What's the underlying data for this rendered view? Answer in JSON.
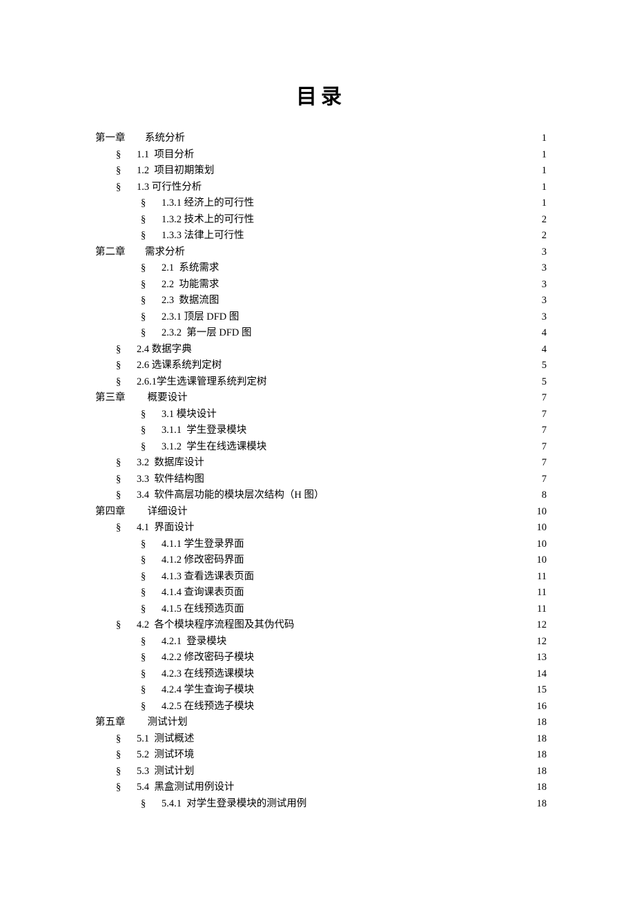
{
  "title": "目录",
  "bullet": "§",
  "entries": [
    {
      "indent": "indent-0",
      "type": "chapter",
      "label": "第一章",
      "text": "系统分析",
      "page": "1"
    },
    {
      "indent": "indent-1",
      "type": "bullet",
      "num": "1.1",
      "text": "项目分析",
      "page": "1"
    },
    {
      "indent": "indent-1",
      "type": "bullet",
      "num": "1.2",
      "text": "项目初期策划",
      "page": "1"
    },
    {
      "indent": "indent-1",
      "type": "bullet",
      "num": "1.3",
      "text": "可行性分析",
      "page": "1",
      "numtight": true
    },
    {
      "indent": "indent-2",
      "type": "bullet",
      "num": "1.3.1",
      "text": "经济上的可行性",
      "page": "1",
      "numtight": true
    },
    {
      "indent": "indent-2",
      "type": "bullet",
      "num": "1.3.2",
      "text": "技术上的可行性",
      "page": "2",
      "numtight": true
    },
    {
      "indent": "indent-2",
      "type": "bullet",
      "num": "1.3.3",
      "text": "法律上可行性",
      "page": "2",
      "numtight": true
    },
    {
      "indent": "indent-0",
      "type": "chapter",
      "label": "第二章",
      "text": "需求分析",
      "page": "3"
    },
    {
      "indent": "indent-2",
      "type": "bullet",
      "num": "2.1",
      "text": "系统需求",
      "page": "3"
    },
    {
      "indent": "indent-2",
      "type": "bullet",
      "num": "2.2",
      "text": "功能需求",
      "page": "3"
    },
    {
      "indent": "indent-2",
      "type": "bullet",
      "num": "2.3",
      "text": "数据流图",
      "page": "3"
    },
    {
      "indent": "indent-2",
      "type": "bullet",
      "num": "2.3.1",
      "text": "顶层 DFD 图",
      "page": "3",
      "numtight": true
    },
    {
      "indent": "indent-2",
      "type": "bullet",
      "num": "2.3.2",
      "text": " 第一层 DFD 图",
      "page": "4",
      "numtight": true
    },
    {
      "indent": "indent-1",
      "type": "bullet",
      "num": "2.4",
      "text": "数据字典",
      "page": "4",
      "numtight": true
    },
    {
      "indent": "indent-1",
      "type": "bullet",
      "num": "2.6",
      "text": "选课系统判定树",
      "page": "5",
      "numtight": true
    },
    {
      "indent": "indent-1",
      "type": "bullet",
      "num": "2.6.1",
      "text": "学生选课管理系统判定树",
      "page": "5",
      "numtight": true,
      "nogap": true
    },
    {
      "indent": "indent-0",
      "type": "chapter",
      "label": "第三章",
      "text": " 概要设计",
      "page": "7"
    },
    {
      "indent": "indent-2",
      "type": "bullet",
      "num": "3.1",
      "text": "模块设计",
      "page": "7",
      "numtight": true
    },
    {
      "indent": "indent-2",
      "type": "bullet",
      "num": "3.1.1",
      "text": " 学生登录模块",
      "page": "7",
      "numtight": true
    },
    {
      "indent": "indent-2",
      "type": "bullet",
      "num": "3.1.2",
      "text": " 学生在线选课模块",
      "page": "7",
      "numtight": true
    },
    {
      "indent": "indent-1",
      "type": "bullet",
      "num": "3.2",
      "text": " 数据库设计",
      "page": "7",
      "numtight": true
    },
    {
      "indent": "indent-1",
      "type": "bullet",
      "num": "3.3",
      "text": " 软件结构图",
      "page": "7",
      "numtight": true
    },
    {
      "indent": "indent-1",
      "type": "bullet",
      "num": "3.4",
      "text": " 软件高层功能的模块层次结构（H 图）",
      "page": "8",
      "numtight": true
    },
    {
      "indent": "indent-0",
      "type": "chapter",
      "label": "第四章",
      "text": " 详细设计",
      "page": "10"
    },
    {
      "indent": "indent-1",
      "type": "bullet",
      "num": "4.1",
      "text": " 界面设计",
      "page": "10",
      "numtight": true
    },
    {
      "indent": "indent-2",
      "type": "bullet",
      "num": "4.1.1",
      "text": "学生登录界面",
      "page": "10",
      "numtight": true
    },
    {
      "indent": "indent-2",
      "type": "bullet",
      "num": "4.1.2",
      "text": "修改密码界面",
      "page": "10",
      "numtight": true
    },
    {
      "indent": "indent-2",
      "type": "bullet",
      "num": "4.1.3",
      "text": "查看选课表页面",
      "page": "11",
      "numtight": true
    },
    {
      "indent": "indent-2",
      "type": "bullet",
      "num": "4.1.4",
      "text": "查询课表页面",
      "page": "11",
      "numtight": true
    },
    {
      "indent": "indent-2",
      "type": "bullet",
      "num": "4.1.5",
      "text": "在线预选页面",
      "page": "11",
      "numtight": true
    },
    {
      "indent": "indent-1",
      "type": "bullet",
      "num": "4.2",
      "text": " 各个模块程序流程图及其伪代码",
      "page": "12",
      "numtight": true
    },
    {
      "indent": "indent-2",
      "type": "bullet",
      "num": "4.2.1",
      "text": " 登录模块",
      "page": "12",
      "numtight": true
    },
    {
      "indent": "indent-2",
      "type": "bullet",
      "num": "4.2.2",
      "text": "修改密码子模块",
      "page": "13",
      "numtight": true
    },
    {
      "indent": "indent-2",
      "type": "bullet",
      "num": "4.2.3",
      "text": "在线预选课模块",
      "page": "14",
      "numtight": true
    },
    {
      "indent": "indent-2",
      "type": "bullet",
      "num": "4.2.4",
      "text": "学生查询子模块",
      "page": "15",
      "numtight": true
    },
    {
      "indent": "indent-2",
      "type": "bullet",
      "num": "4.2.5",
      "text": "在线预选子模块",
      "page": "16",
      "numtight": true
    },
    {
      "indent": "indent-0",
      "type": "chapter",
      "label": "第五章",
      "text": " 测试计划",
      "page": "18"
    },
    {
      "indent": "indent-1",
      "type": "bullet",
      "num": "5.1",
      "text": " 测试概述",
      "page": "18",
      "numtight": true
    },
    {
      "indent": "indent-1",
      "type": "bullet",
      "num": "5.2",
      "text": " 测试环境",
      "page": "18",
      "numtight": true
    },
    {
      "indent": "indent-1",
      "type": "bullet",
      "num": "5.3",
      "text": " 测试计划",
      "page": "18",
      "numtight": true
    },
    {
      "indent": "indent-1",
      "type": "bullet",
      "num": "5.4",
      "text": " 黑盒测试用例设计",
      "page": "18",
      "numtight": true
    },
    {
      "indent": "indent-2",
      "type": "bullet",
      "num": "5.4.1",
      "text": " 对学生登录模块的测试用例",
      "page": "18",
      "numtight": true
    }
  ]
}
